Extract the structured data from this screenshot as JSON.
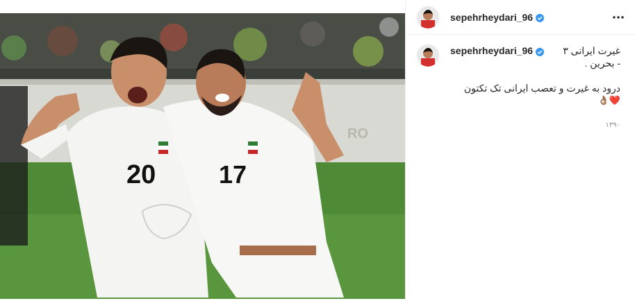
{
  "post": {
    "username": "sepehrheydari_96",
    "verified": true,
    "more_icon": "more-horizontal-icon",
    "caption": {
      "username": "sepehrheydari_96",
      "line1": "غیرت ایرانی ۳",
      "line2": "- بحرین .",
      "line3": "درود به غیرت و تعصب ایرانی تک تکتون",
      "emojis": "❤️👌🏽",
      "time": "۱۳۹۰"
    },
    "photo": {
      "jersey_left": "20",
      "jersey_right": "17"
    }
  },
  "colors": {
    "verified_blue": "#3897f0",
    "text": "#262626",
    "muted": "#8e8e8e",
    "heart": "#e0245e"
  }
}
